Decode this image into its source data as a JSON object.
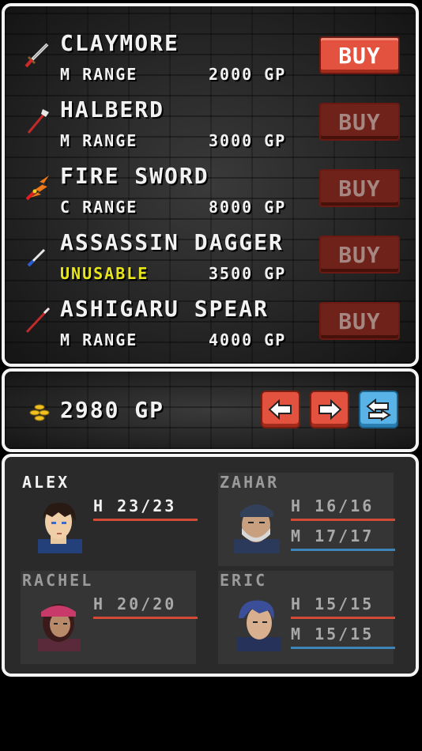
{
  "shop": {
    "items": [
      {
        "name": "CLAYMORE",
        "sub": "M RANGE",
        "price": "2000 GP",
        "buy_label": "BUY",
        "enabled": true,
        "icon": "claymore-icon"
      },
      {
        "name": "HALBERD",
        "sub": "M RANGE",
        "price": "3000 GP",
        "buy_label": "BUY",
        "enabled": false,
        "icon": "halberd-icon"
      },
      {
        "name": "FIRE SWORD",
        "sub": "C RANGE",
        "price": "8000 GP",
        "buy_label": "BUY",
        "enabled": false,
        "icon": "fire-sword-icon"
      },
      {
        "name": "ASSASSIN DAGGER",
        "sub": "UNUSABLE",
        "price": "3500 GP",
        "buy_label": "BUY",
        "enabled": false,
        "icon": "dagger-icon"
      },
      {
        "name": "ASHIGARU SPEAR",
        "sub": "M RANGE",
        "price": "4000 GP",
        "buy_label": "BUY",
        "enabled": false,
        "icon": "spear-icon"
      }
    ]
  },
  "gold": {
    "amount": "2980 GP",
    "icon": "gold-coins-icon"
  },
  "nav": {
    "prev_icon": "arrow-left-icon",
    "next_icon": "arrow-right-icon",
    "swap_icon": "swap-icon"
  },
  "party": {
    "members": [
      {
        "name": "ALEX",
        "hp": "H 23/23",
        "mp": null
      },
      {
        "name": "ZAHAR",
        "hp": "H 16/16",
        "mp": "M 17/17"
      },
      {
        "name": "RACHEL",
        "hp": "H 20/20",
        "mp": null
      },
      {
        "name": "ERIC",
        "hp": "H 15/15",
        "mp": "M 15/15"
      }
    ]
  },
  "colors": {
    "buy_active": "#e3523e",
    "buy_inactive": "#6e2219",
    "unusable": "#e7e51e",
    "hp_bar": "#d34a37",
    "mp_bar": "#3d84b8",
    "nav_blue": "#59b3e6"
  }
}
